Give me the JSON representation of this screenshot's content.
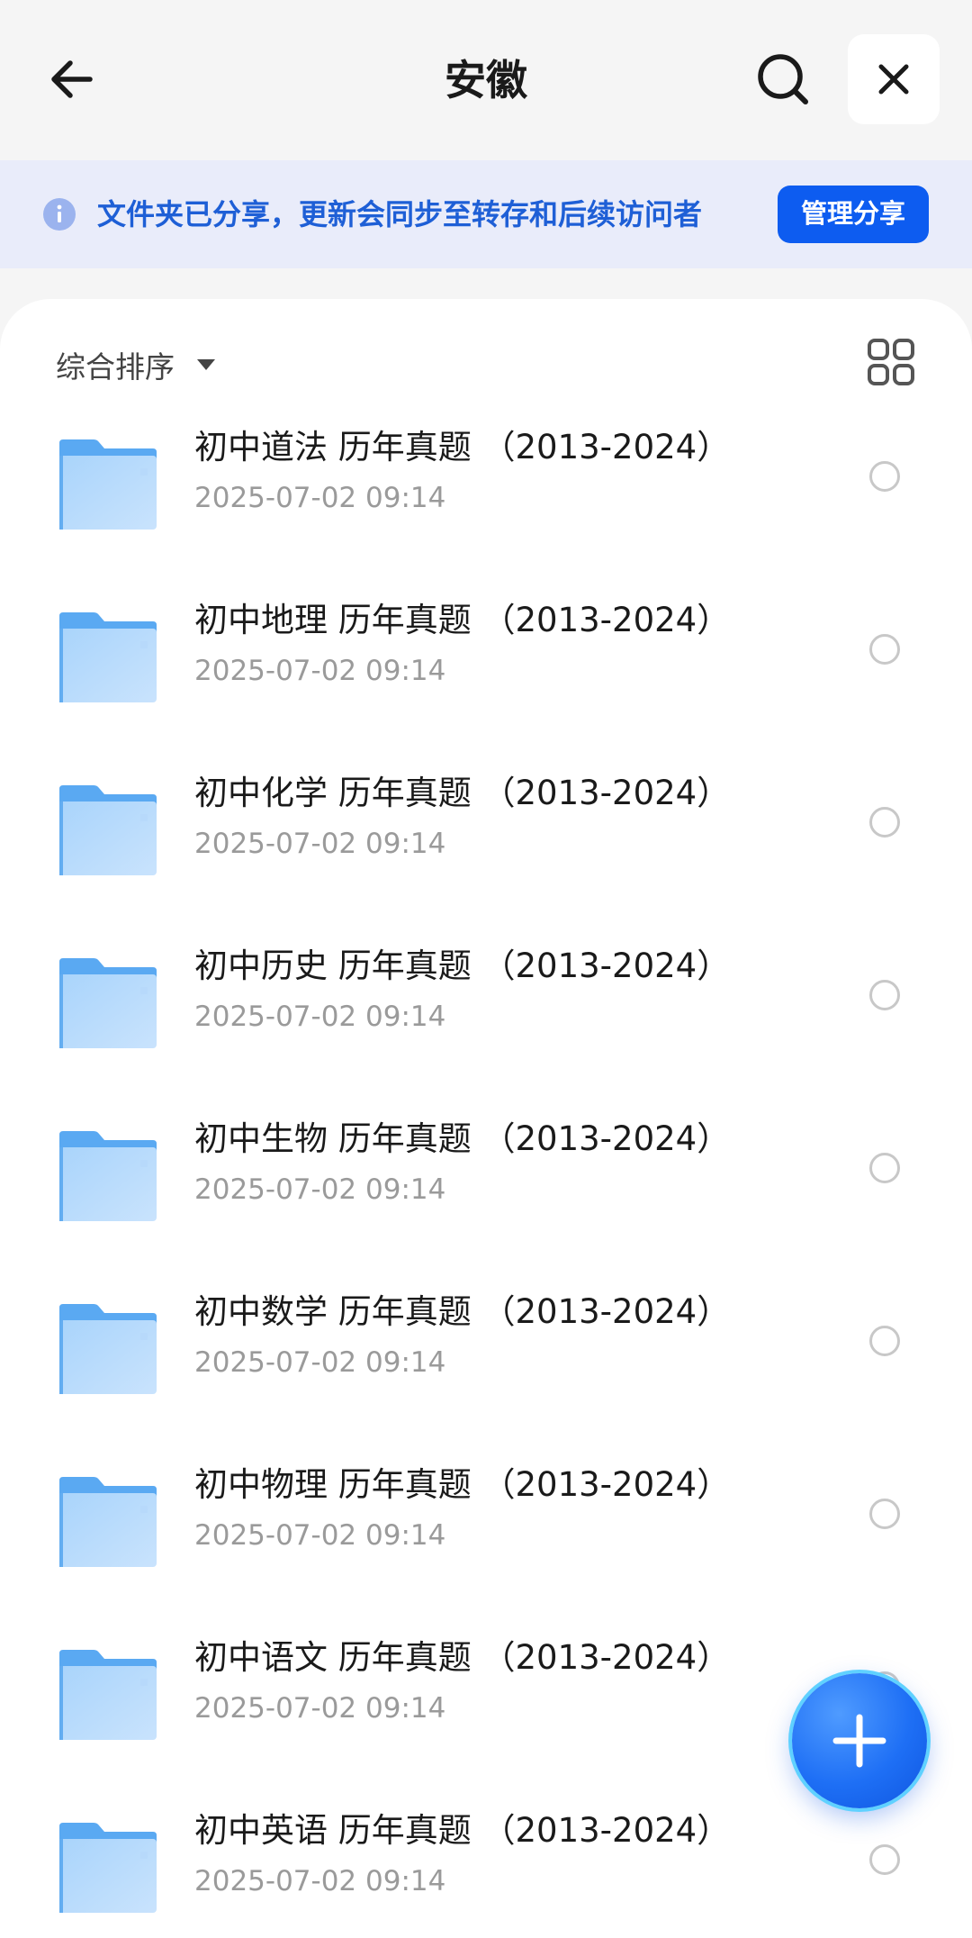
{
  "header": {
    "title": "安徽",
    "back_icon": "arrow-left-icon",
    "search_icon": "search-icon",
    "close_icon": "close-icon"
  },
  "banner": {
    "text": "文件夹已分享，更新会同步至转存和后续访问者",
    "button_label": "管理分享",
    "icon": "info-icon"
  },
  "toolbar": {
    "sort_label": "综合排序",
    "sort_icon": "caret-down-icon",
    "view_icon": "grid-view-icon"
  },
  "items": [
    {
      "name": "初中道法 历年真题 （2013-2024）",
      "date": "2025-07-02 09:14"
    },
    {
      "name": "初中地理 历年真题 （2013-2024）",
      "date": "2025-07-02 09:14"
    },
    {
      "name": "初中化学 历年真题 （2013-2024）",
      "date": "2025-07-02 09:14"
    },
    {
      "name": "初中历史 历年真题 （2013-2024）",
      "date": "2025-07-02 09:14"
    },
    {
      "name": "初中生物 历年真题 （2013-2024）",
      "date": "2025-07-02 09:14"
    },
    {
      "name": "初中数学 历年真题 （2013-2024）",
      "date": "2025-07-02 09:14"
    },
    {
      "name": "初中物理 历年真题 （2013-2024）",
      "date": "2025-07-02 09:14"
    },
    {
      "name": "初中语文 历年真题 （2013-2024）",
      "date": "2025-07-02 09:14"
    },
    {
      "name": "初中英语 历年真题 （2013-2024）",
      "date": "2025-07-02 09:14"
    }
  ],
  "fab": {
    "icon": "plus-icon"
  },
  "colors": {
    "accent": "#0d5cf0",
    "banner_bg": "#e9ecfa",
    "banner_text": "#1e5fd6",
    "folder": "#8cc6fa"
  }
}
